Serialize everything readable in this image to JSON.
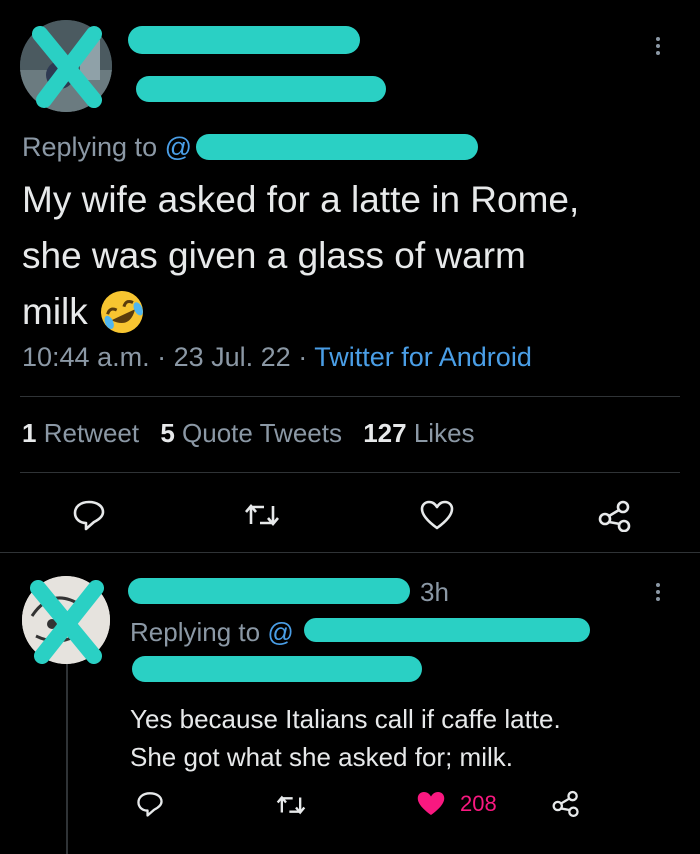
{
  "main_tweet": {
    "replying_to_label": "Replying to",
    "replying_to_handle": "@",
    "text_line1": "My wife asked for a latte in Rome,",
    "text_line2": "she was given a glass of warm",
    "text_line3": "milk",
    "time": "10:44 a.m.",
    "date": "23 Jul. 22",
    "source": "Twitter for Android",
    "dot": "·",
    "stats": {
      "retweets_count": "1",
      "retweets_label": "Retweet",
      "quotes_count": "5",
      "quotes_label": "Quote Tweets",
      "likes_count": "127",
      "likes_label": "Likes"
    },
    "icons": [
      "reply-icon",
      "retweet-icon",
      "heart-icon",
      "share-icon"
    ]
  },
  "reply_tweet": {
    "time_ago": "3h",
    "replying_to_label": "Replying to",
    "replying_to_handle": "@",
    "text_line1": "Yes because Italians call if caffe latte.",
    "text_line2": "She got what she asked for; milk.",
    "likes_count": "208",
    "like_color": "#f91880",
    "icons": [
      "reply-icon",
      "retweet-icon",
      "heart-filled-icon",
      "share-icon"
    ]
  },
  "colors": {
    "background": "#000000",
    "text": "#e7e9ea",
    "secondary": "#8b98a5",
    "link": "#4a9ee6",
    "redaction": "#2ad0c4"
  }
}
